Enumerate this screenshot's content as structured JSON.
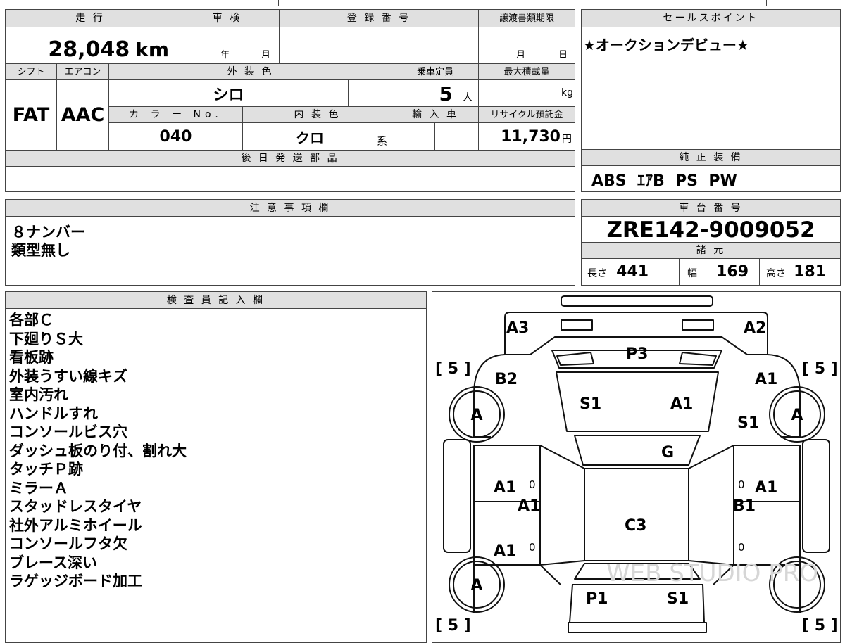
{
  "basic": {
    "mileage_label": "走 行",
    "mileage_value": "28,048",
    "mileage_unit": "km",
    "inspection_label": "車 検",
    "inspection_year": "年",
    "inspection_month": "月",
    "registration_label": "登 録 番 号",
    "registration_value": "",
    "transfer_label": "譲渡書類期限",
    "transfer_month": "月",
    "transfer_day": "日",
    "shift_label": "シフト",
    "shift_value": "FAT",
    "ac_label": "エアコン",
    "ac_value": "AAC",
    "exterior_label": "外 装 色",
    "exterior_value": "シロ",
    "capacity_label": "乗車定員",
    "capacity_value": "5",
    "capacity_unit": "人",
    "maxload_label": "最大積載量",
    "maxload_unit": "kg",
    "color_no_label": "カ ラ ー No.",
    "color_no_value": "040",
    "interior_label": "内 装 色",
    "interior_value": "クロ",
    "interior_suffix": "系",
    "import_label": "輸 入 車",
    "recycle_label": "リサイクル預託金",
    "recycle_value": "11,730",
    "recycle_unit": "円"
  },
  "sales": {
    "label": "セールスポイント",
    "text": "★オークションデビュー★"
  },
  "equipment": {
    "label": "純 正 装 備",
    "value": "ABS  ｴｱB  PS  PW"
  },
  "later_parts": {
    "label": "後 日 発 送 部 品",
    "value": ""
  },
  "notes": {
    "label": "注 意 事 項 欄",
    "lines": [
      "８ナンバー",
      "類型無し"
    ]
  },
  "chassis": {
    "label": "車 台 番 号",
    "value": "ZRE142-9009052",
    "spec_label": "諸 元",
    "length_label": "長さ",
    "length_value": "441",
    "width_label": "幅",
    "width_value": "169",
    "height_label": "高さ",
    "height_value": "181"
  },
  "inspector": {
    "label": "検 査 員 記 入 欄",
    "lines": [
      "各部Ｃ",
      "下廻りＳ大",
      "看板跡",
      "外装うすい線キズ",
      "室内汚れ",
      "ハンドルすれ",
      "コンソールビス穴",
      "ダッシュ板のり付、割れ大",
      "タッチＰ跡",
      "ミラーＡ",
      "スタッドレスタイヤ",
      "社外アルミホイール",
      "コンソールフタ欠",
      "ブレース深い",
      "ラゲッジボード加工"
    ]
  },
  "diagram": {
    "tire_marks": [
      "[ 5 ]",
      "[ 5 ]",
      "[ 5 ]",
      "[ 5 ]"
    ],
    "wheel_marks": [
      "A",
      "A",
      "A"
    ],
    "damage_codes": {
      "rear_left": "A3",
      "rear_right": "A2",
      "rear_glass": "P3",
      "b2": "B2",
      "a1_right_rear": "A1",
      "s1_roof_left": "S1",
      "a1_roof_right": "A1",
      "s1_right_quarter": "S1",
      "g_center": "G",
      "a1_left_door_upper": "A1",
      "a1_left_door_mid": "A1",
      "a1_right_door_upper": "A1",
      "b1_right_door_mid": "B1",
      "c3_roof": "C3",
      "a1_left_door_lower": "A1",
      "p1_front_glass": "P1",
      "s1_front_right": "S1",
      "zero_1": "0",
      "zero_2": "0",
      "zero_3": "0",
      "zero_4": "0"
    },
    "watermark": "WEB STUDIO PRO"
  }
}
